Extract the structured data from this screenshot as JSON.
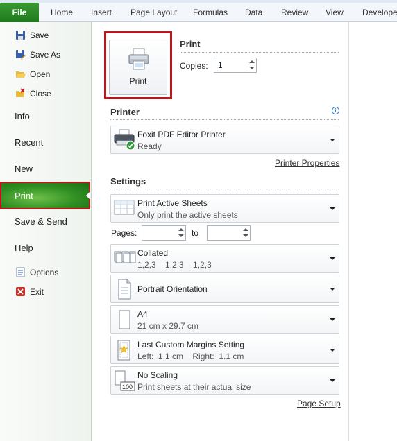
{
  "ribbon": {
    "file": "File",
    "tabs": [
      "Home",
      "Insert",
      "Page Layout",
      "Formulas",
      "Data",
      "Review",
      "View",
      "Developer"
    ]
  },
  "nav": {
    "save": "Save",
    "save_as": "Save As",
    "open": "Open",
    "close": "Close",
    "info": "Info",
    "recent": "Recent",
    "new": "New",
    "print": "Print",
    "save_send": "Save & Send",
    "help": "Help",
    "options": "Options",
    "exit": "Exit"
  },
  "print": {
    "button_label": "Print",
    "heading": "Print",
    "copies_label": "Copies:",
    "copies_value": "1"
  },
  "printer": {
    "heading": "Printer",
    "name": "Foxit PDF Editor Printer",
    "status": "Ready",
    "properties_link": "Printer Properties"
  },
  "settings": {
    "heading": "Settings",
    "sheets": {
      "title": "Print Active Sheets",
      "subtitle": "Only print the active sheets"
    },
    "pages_label": "Pages:",
    "to_label": "to",
    "pages_from": "",
    "pages_to": "",
    "collation": {
      "title": "Collated",
      "subtitle": "1,2,3    1,2,3    1,2,3"
    },
    "orientation": {
      "title": "Portrait Orientation"
    },
    "paper": {
      "title": "A4",
      "subtitle": "21 cm x 29.7 cm"
    },
    "margins": {
      "title": "Last Custom Margins Setting",
      "subtitle": "Left:  1.1 cm    Right:  1.1 cm"
    },
    "scaling": {
      "title": "No Scaling",
      "subtitle": "Print sheets at their actual size"
    },
    "page_setup_link": "Page Setup"
  },
  "colors": {
    "file_tab": "#2a8a25",
    "print_nav_highlight": "#c0131c",
    "link": "#333333"
  }
}
